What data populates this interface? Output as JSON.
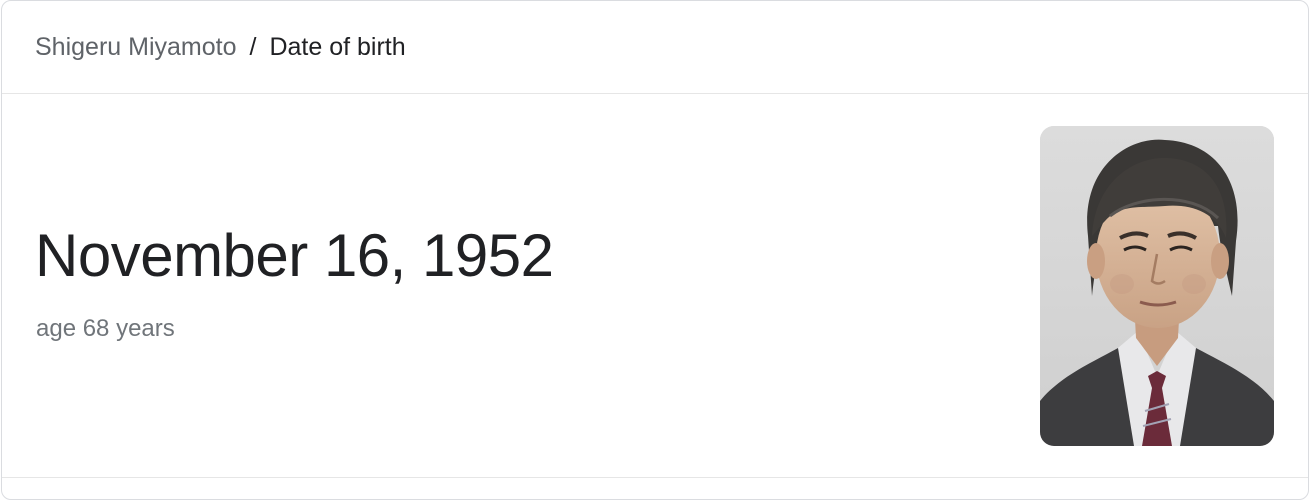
{
  "breadcrumb": {
    "parent": "Shigeru Miyamoto",
    "separator": "/",
    "current": "Date of birth"
  },
  "answer": {
    "value": "November 16, 1952",
    "subtext": "age 68 years"
  },
  "image": {
    "subject": "portrait-photo",
    "background_color": "#d6d6d6"
  }
}
